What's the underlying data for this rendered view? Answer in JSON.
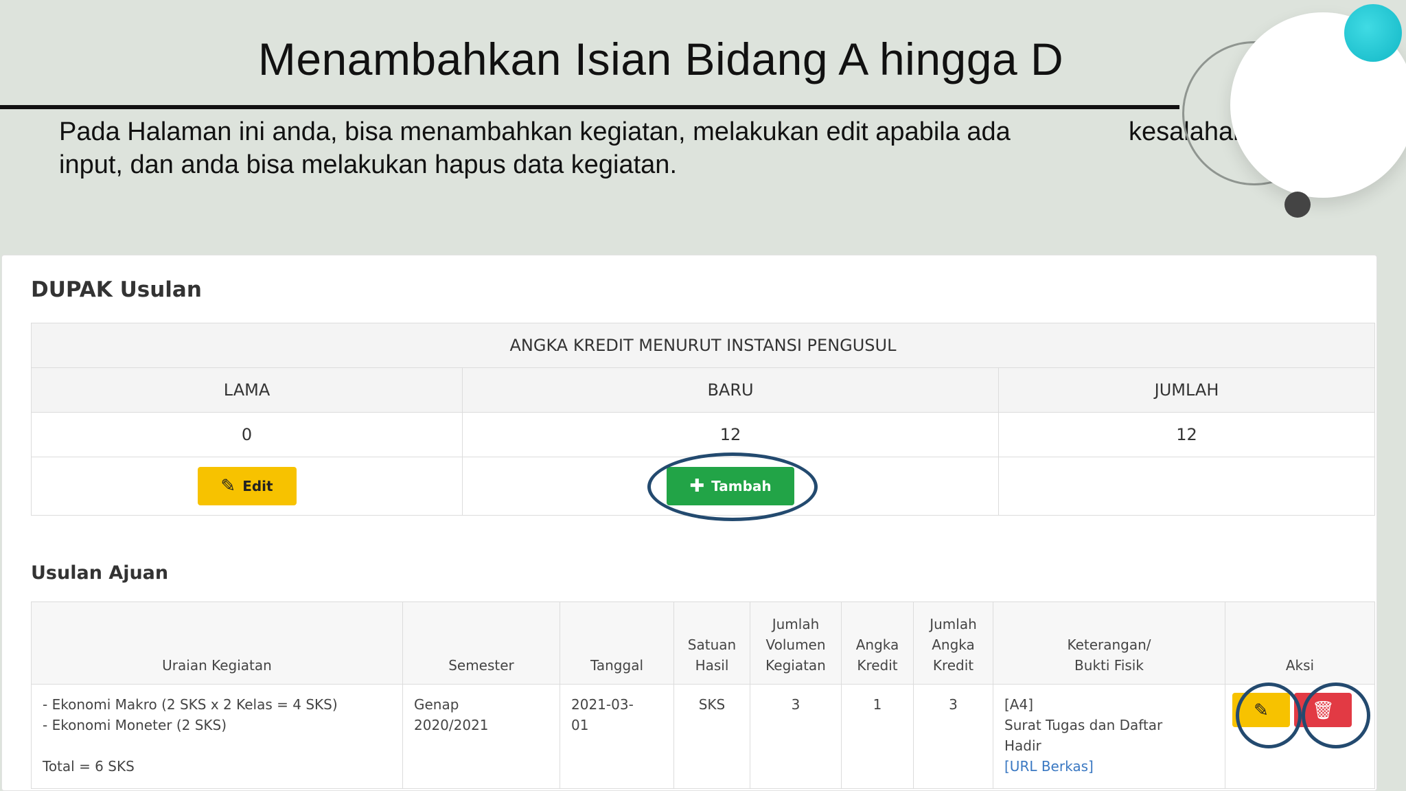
{
  "slide": {
    "title": "Menambahkan Isian Bidang A hingga D",
    "desc_line1": "Pada Halaman ini anda, bisa menambahkan kegiatan, melakukan edit apabila ada",
    "desc_gap_word": "kesalahan",
    "desc_line2": "input, dan anda bisa melakukan hapus data kegiatan."
  },
  "dupak": {
    "title": "DUPAK Usulan",
    "table_header": "ANGKA KREDIT MENURUT INSTANSI PENGUSUL",
    "columns": [
      "LAMA",
      "BARU",
      "JUMLAH"
    ],
    "values": [
      "0",
      "12",
      "12"
    ],
    "edit_label": "Edit",
    "add_label": "Tambah"
  },
  "ajuan": {
    "title": "Usulan Ajuan",
    "columns": {
      "uraian": "Uraian Kegiatan",
      "semester": "Semester",
      "tanggal": "Tanggal",
      "satuan_1": "Satuan",
      "satuan_2": "Hasil",
      "volume_1": "Jumlah",
      "volume_2": "Volumen",
      "volume_3": "Kegiatan",
      "angka_1": "Angka",
      "angka_2": "Kredit",
      "jumlah_1": "Jumlah",
      "jumlah_2": "Angka",
      "jumlah_3": "Kredit",
      "ket_1": "Keterangan/",
      "ket_2": "Bukti Fisik",
      "aksi": "Aksi"
    },
    "row": {
      "uraian_1": "- Ekonomi Makro (2 SKS x 2 Kelas = 4 SKS)",
      "uraian_2": "- Ekonomi Moneter (2 SKS)",
      "uraian_total": "Total = 6 SKS",
      "semester_1": "Genap",
      "semester_2": "2020/2021",
      "tanggal_1": "2021-03-",
      "tanggal_2": "01",
      "satuan": "SKS",
      "volume": "3",
      "angka": "1",
      "jumlah": "3",
      "ket_code": "[A4]",
      "ket_1": "Surat Tugas dan Daftar",
      "ket_2": "Hadir",
      "ket_link": "[URL Berkas]"
    }
  },
  "colors": {
    "slide_bg": "#dde3dc",
    "edit_yellow": "#f7c200",
    "add_green": "#22a447",
    "delete_red": "#e23a44",
    "highlight_ring": "#234a6f",
    "accent_cyan": "#12b7c6"
  },
  "icons": {
    "edit": "edit-icon",
    "add": "plus-icon",
    "delete": "trash-icon"
  }
}
